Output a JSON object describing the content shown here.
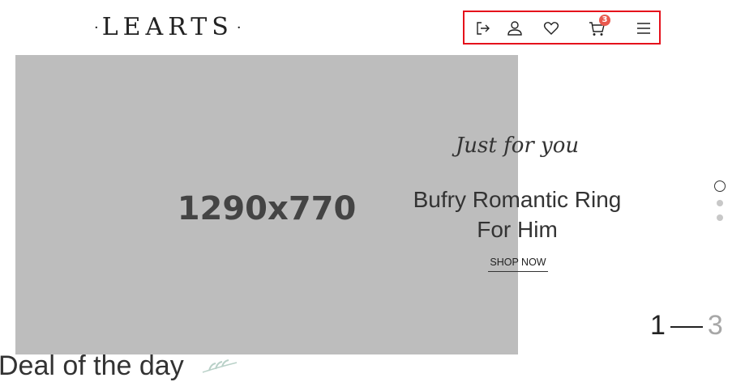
{
  "header": {
    "logo_text": "LEARTS",
    "logo_dot": "·",
    "toolbar": [
      {
        "icon": "logout-icon"
      },
      {
        "icon": "user-icon"
      },
      {
        "icon": "heart-icon"
      },
      {
        "icon": "cart-icon",
        "badge": "3"
      },
      {
        "icon": "menu-icon"
      }
    ],
    "highlight_color": "#e5101b",
    "badge_color": "#e9594f"
  },
  "hero": {
    "image_placeholder": "1290x770",
    "tagline": "Just for you",
    "headline_line1": "Bufry Romantic Ring",
    "headline_line2": "For Him",
    "cta": "SHOP NOW"
  },
  "slider": {
    "current": "1",
    "total": "3",
    "active_dot": 0
  },
  "section": {
    "title": "Deal of the day"
  }
}
